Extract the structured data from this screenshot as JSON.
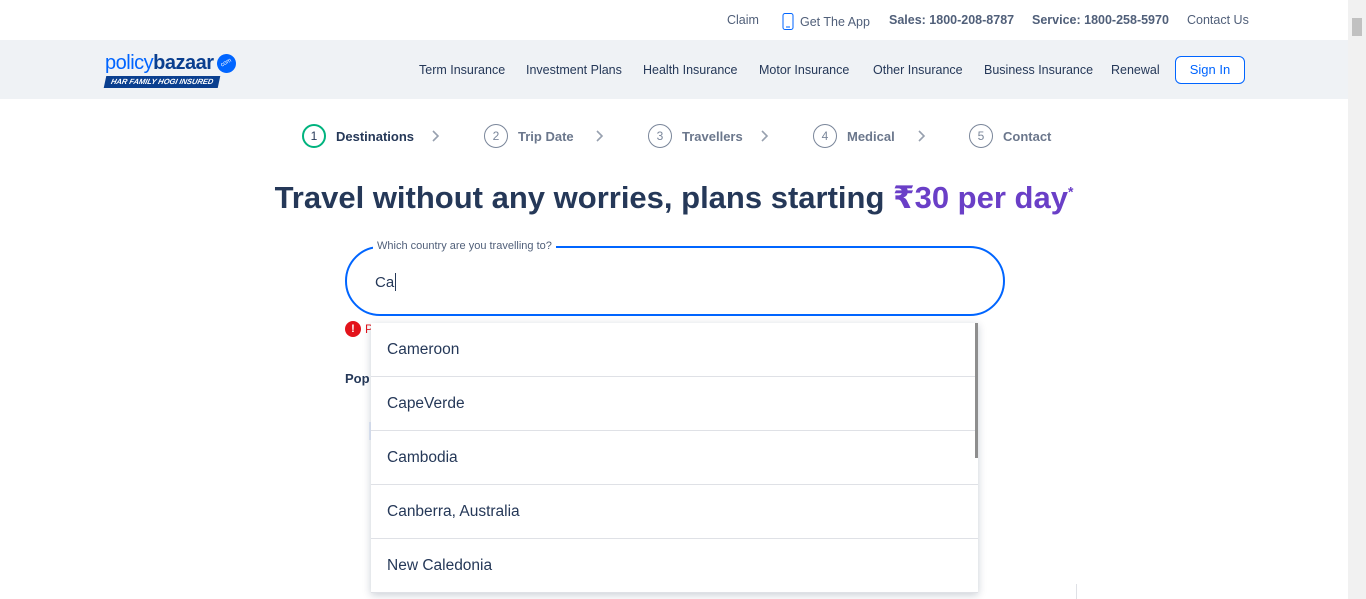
{
  "utility": {
    "claim": "Claim",
    "get_app": "Get The App",
    "sales": "Sales: 1800-208-8787",
    "service": "Service: 1800-258-5970",
    "contact": "Contact Us"
  },
  "logo": {
    "word_light": "policy",
    "word_bold": "bazaar",
    "badge": "com",
    "tagline": "HAR FAMILY HOGI INSURED"
  },
  "nav": {
    "items": [
      "Term Insurance",
      "Investment Plans",
      "Health Insurance",
      "Motor Insurance",
      "Other Insurance",
      "Business Insurance",
      "Renewal"
    ],
    "signin": "Sign In"
  },
  "steps": [
    {
      "num": "1",
      "label": "Destinations",
      "active": true
    },
    {
      "num": "2",
      "label": "Trip Date",
      "active": false
    },
    {
      "num": "3",
      "label": "Travellers",
      "active": false
    },
    {
      "num": "4",
      "label": "Medical",
      "active": false
    },
    {
      "num": "5",
      "label": "Contact",
      "active": false
    }
  ],
  "heading": {
    "main": "Travel without any worries, plans starting ",
    "accent": "₹30 per day",
    "star": "*"
  },
  "country_field": {
    "label": "Which country are you travelling to?",
    "value": "Ca"
  },
  "error_partial": "P",
  "popular_partial": "Pop",
  "dropdown": {
    "options": [
      "Cameroon",
      "CapeVerde",
      "Cambodia",
      "Canberra, Australia",
      "New Caledonia"
    ]
  },
  "colors": {
    "brand_blue": "#0065ff",
    "active_step": "#00b37e",
    "accent_purple": "#6a3fc7",
    "error_red": "#e3131b"
  }
}
